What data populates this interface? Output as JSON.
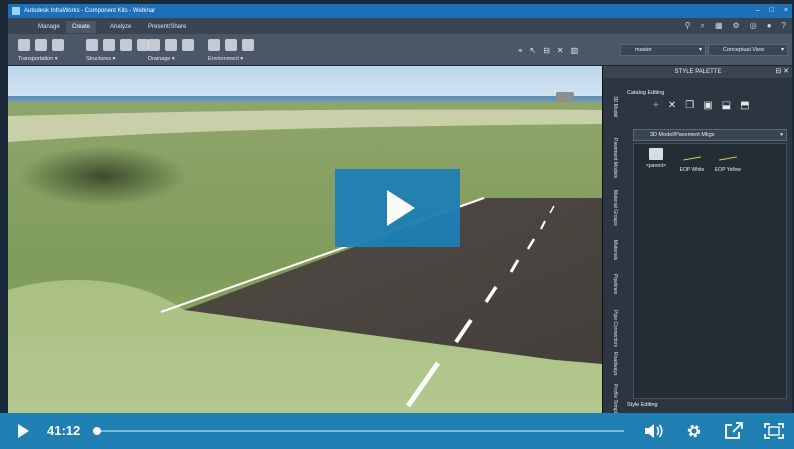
{
  "window": {
    "title": "Autodesk InfraWorks - Component Kits - Webinar",
    "controls": [
      "–",
      "□",
      "×"
    ]
  },
  "ribbon": {
    "tabs": [
      "Manage",
      "Create",
      "Analyze",
      "Present/Share"
    ],
    "active_tab": "Create",
    "groups": [
      {
        "label": "Transportation ▾"
      },
      {
        "label": "Structures ▾"
      },
      {
        "label": "Drainage ▾"
      },
      {
        "label": "Environment ▾"
      }
    ],
    "proposal_dropdown": "master",
    "visual_style_dropdown": "Conceptual View"
  },
  "palette": {
    "title": "STYLE PALETTE",
    "vertical_tabs": [
      "3D Model",
      "Pavement Models",
      "Material Groups",
      "Materials",
      "Pipelines",
      "Pipe Connectors",
      "Roadways",
      "Profile Templates"
    ],
    "catalog_editing_label": "Catalog Editing",
    "category_dropdown": "3D Model/Pavement Mkgs",
    "items": [
      {
        "label": "<parent>",
        "icon": "folder-icon"
      },
      {
        "label": "EOP White",
        "icon": "line-marking-icon"
      },
      {
        "label": "EOP Yellow",
        "icon": "line-marking-icon"
      }
    ],
    "style_editing_label": "Style Editing"
  },
  "player": {
    "timecode": "41:12",
    "progress": 0,
    "accent_color": "#1f7fb3"
  },
  "colors": {
    "road": "#4a4540",
    "grass": "#8aa764",
    "marking": "#ffffff"
  }
}
